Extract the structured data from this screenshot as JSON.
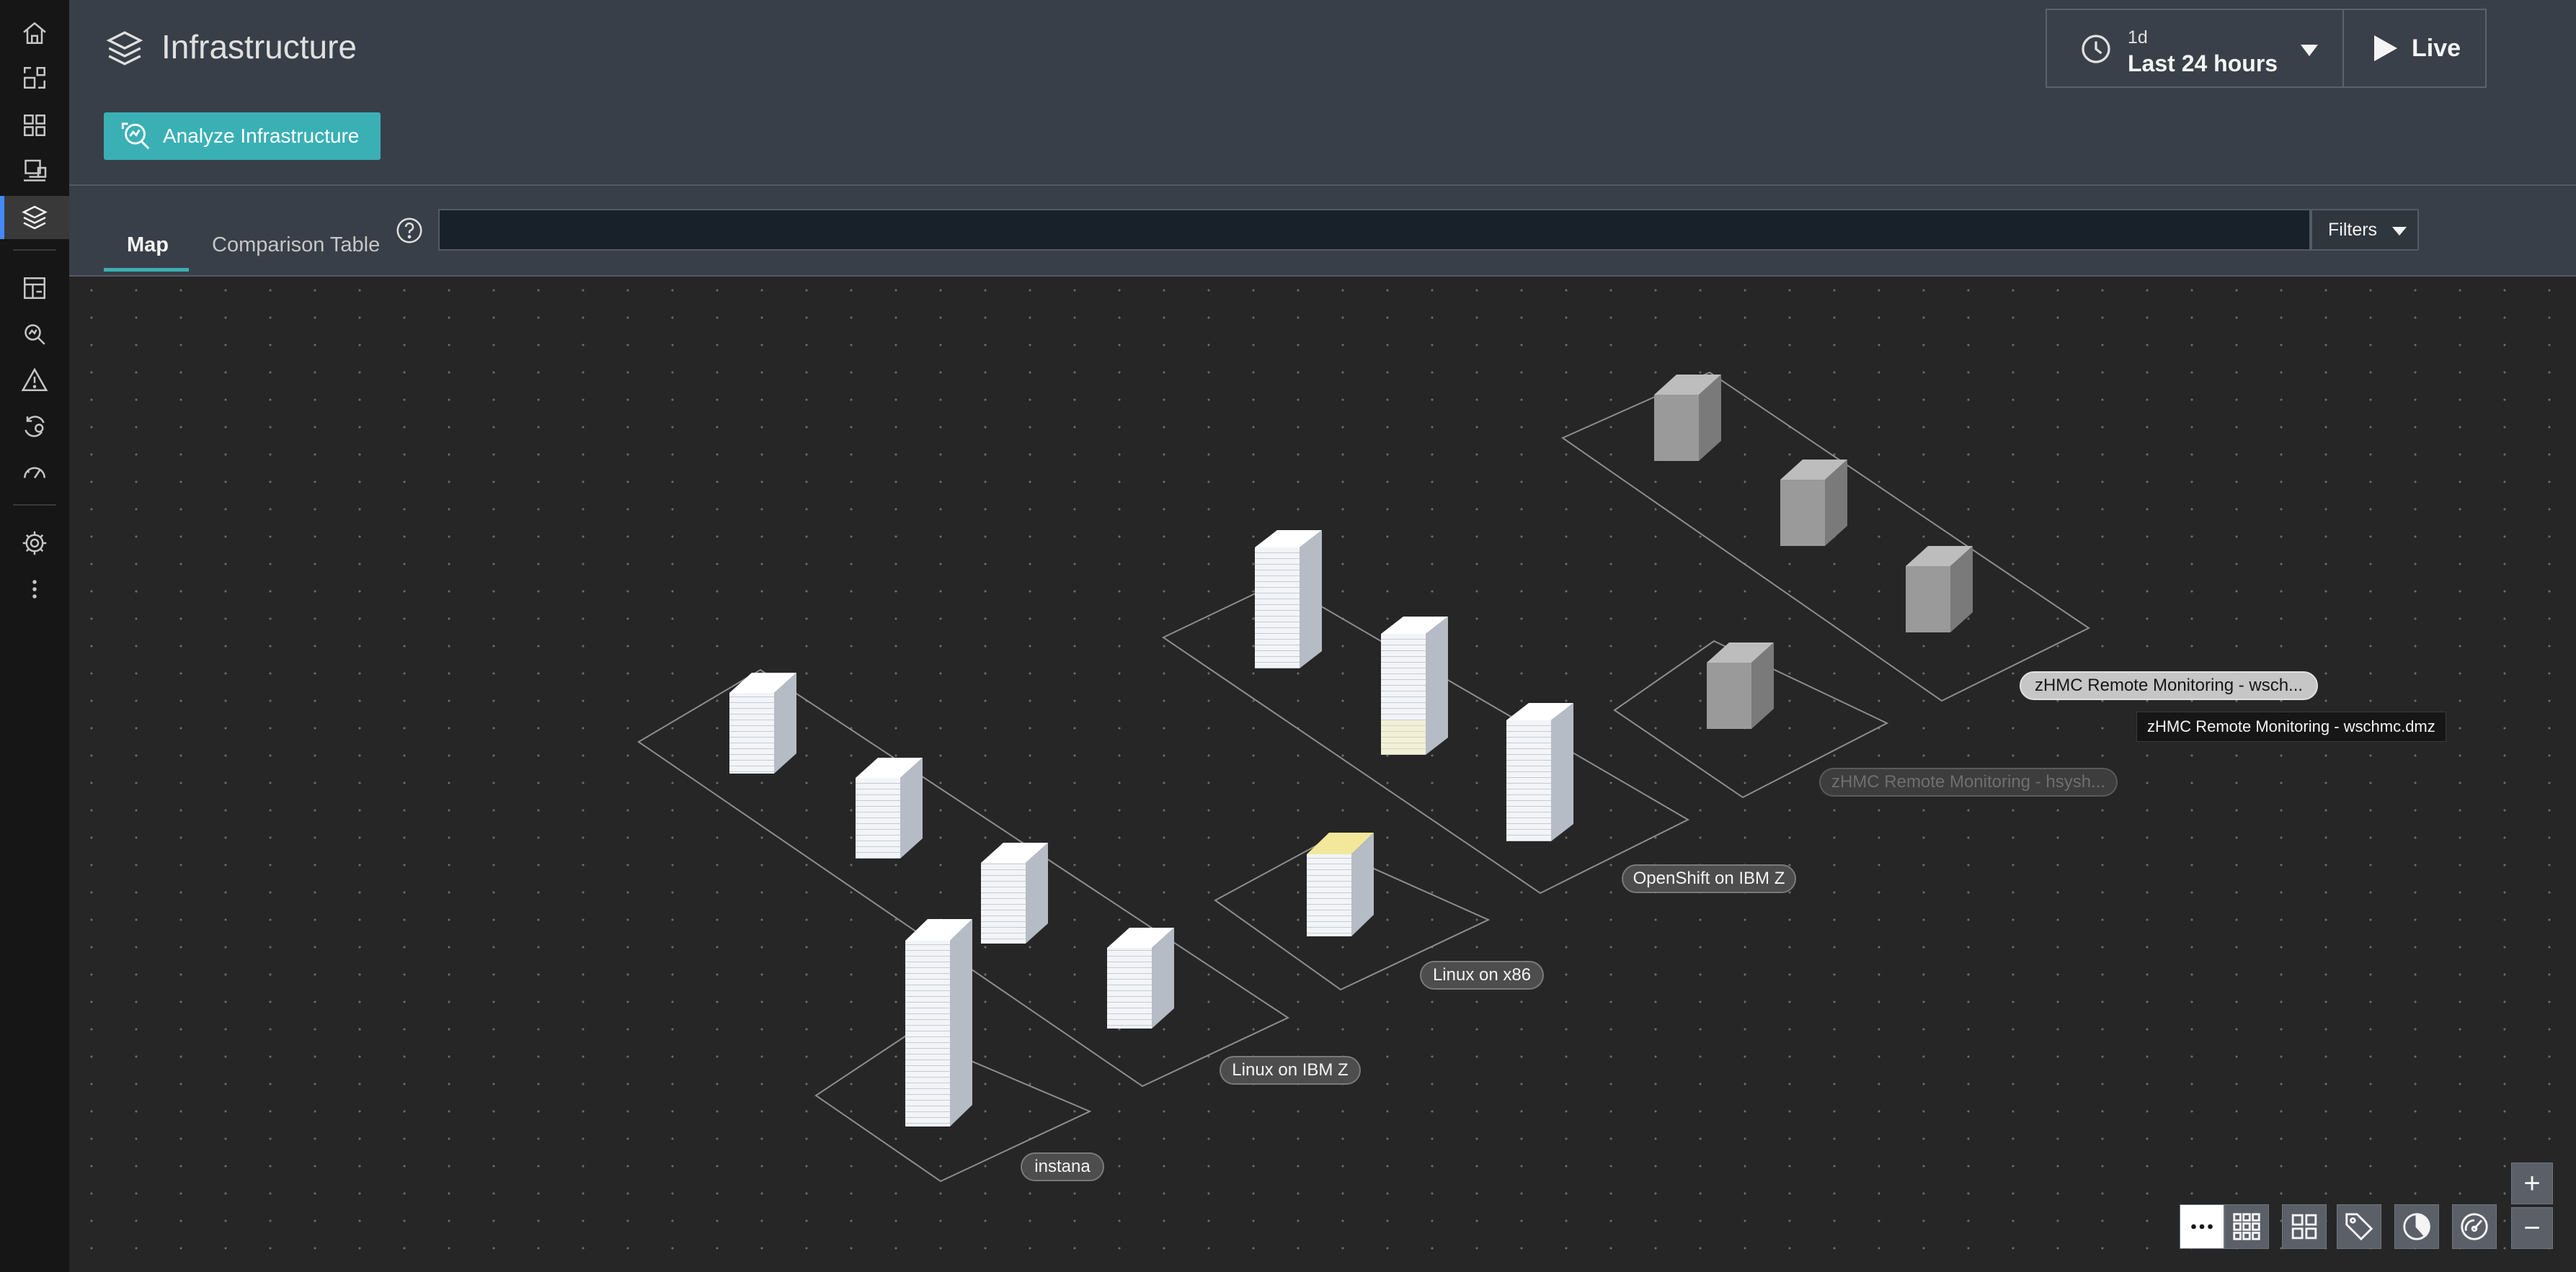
{
  "header": {
    "title": "Infrastructure",
    "analyze_button": "Analyze Infrastructure",
    "time_range_short": "1d",
    "time_range_label": "Last 24 hours",
    "live_label": "Live"
  },
  "tabs": {
    "map": "Map",
    "comparison": "Comparison Table"
  },
  "search": {
    "value": ""
  },
  "filters_label": "Filters",
  "map": {
    "group_labels": [
      "zHMC Remote Monitoring - wsch...",
      "zHMC Remote Monitoring - hsysh...",
      "OpenShift on IBM Z",
      "Linux on x86",
      "Linux on IBM Z",
      "instana"
    ],
    "tooltip": "zHMC Remote Monitoring - wschmc.dmz"
  },
  "zoom": {
    "in": "+",
    "out": "−"
  },
  "colors": {
    "accent": "#3ab0b5",
    "highlight_host": "#f3e79a"
  }
}
